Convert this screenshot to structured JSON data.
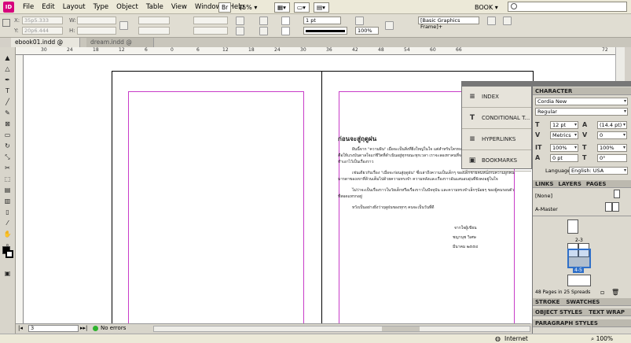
{
  "app": {
    "logo": "ID"
  },
  "menu": [
    "File",
    "Edit",
    "Layout",
    "Type",
    "Object",
    "Table",
    "View",
    "Window",
    "Help"
  ],
  "menubar": {
    "zoom": "75%",
    "workspace": "BOOK",
    "search_placeholder": ""
  },
  "control": {
    "x_label": "X:",
    "x_value": "35p5.333",
    "y_label": "Y:",
    "y_value": "20p6.444",
    "w_label": "W:",
    "h_label": "H:",
    "stroke_weight": "1 pt",
    "opacity": "100%",
    "frame_style": "[Basic Graphics Frame]+"
  },
  "tabs": [
    {
      "label": "ebook01.indd @ 75%",
      "close": "×"
    },
    {
      "label": "dream.indd @ 93%",
      "close": "×"
    }
  ],
  "ruler_ticks": [
    "30",
    "24",
    "18",
    "12",
    "6",
    "0",
    "6",
    "12",
    "18",
    "24",
    "30",
    "36",
    "42",
    "48",
    "54",
    "60",
    "66",
    "72"
  ],
  "page": {
    "heading": "ก่อนจะสู่ฤดูฝน",
    "para1_line1": "ฝันนี้จาก \"ความฝัน\" เมื่อจะเป็นสิ่งที่ยิ่งใหญ่ในใจ แต่สำหรับใครหลายคน",
    "para1_line2": "คือให้แรงบันดาลใจแก่ชีวิตที่ดำเนินอยู่ทุกขณะทุกเวลา เราจะลองหาคนที่จะเก็บสิ่งต่างๆเอาไว้",
    "para1_line3": "ทำเอาไว้เป็นเรื่องราว",
    "para2_line1": "เช่นเดียวกับเรื่อง \"เมื่อจะก่อนสู่ฤดูฝน\" ซึ่งเล่าถึงความเป็นเด็กๆ ของเด็กชายคนหนึ่งกับความผูกพัน",
    "para2_line2": "มารดาของเขาที่ล้วนเต็มไปด้วยความทรงจำ ความหลังและเรื่องราวอันแสนอบอุ่นที่ยังคงอยู่ในใจ",
    "para3_line1": "ไม่ว่าจะเป็นเรื่องราวในวัยเด็กหรือเรื่องราวในปัจจุบัน และความทรงจำเล็กๆน้อยๆ ของผู้คนรอบตัว",
    "para3_line2": "ที่สอดแทรกอยู่",
    "closing": "หวังเป็นอย่างยิ่งว่าฤดูฝนของทุกๆ คนจะเป็นวันที่ดี",
    "sig1": "จากใจผู้เขียน",
    "sig2": "ชญานุช วิเศษ",
    "sig3": "มีนาคม ๒๕๕๔"
  },
  "float_panel": [
    {
      "icon": "≡",
      "label": "INDEX"
    },
    {
      "icon": "T",
      "label": "CONDITIONAL T..."
    },
    {
      "icon": "≡",
      "label": "HYPERLINKS"
    },
    {
      "icon": "▣",
      "label": "BOOKMARKS"
    }
  ],
  "character": {
    "title": "CHARACTER",
    "font": "Cordia New",
    "style": "Regular",
    "size": "12 pt",
    "leading": "(14.4 pt)",
    "kerning": "Metrics",
    "tracking": "0",
    "vscale": "100%",
    "hscale": "100%",
    "baseline": "0 pt",
    "skew": "0°",
    "language_label": "Language:",
    "language": "English: USA"
  },
  "pages_panel": {
    "tabs": [
      "LINKS",
      "LAYERS",
      "PAGES"
    ],
    "none_label": "[None]",
    "master_label": "A-Master",
    "spread1": "2-3",
    "spread2": "4-5",
    "footer": "48 Pages in 25 Spreads"
  },
  "bottom_panels": {
    "stroke": "STROKE",
    "swatches": "SWATCHES",
    "object_styles": "OBJECT STYLES",
    "text_wrap": "TEXT WRAP",
    "paragraph_styles": "PARAGRAPH STYLES"
  },
  "statusbar": {
    "page": "3",
    "errors": "No errors"
  },
  "browser": {
    "zone": "Internet",
    "zoom": "100%"
  },
  "colors": {
    "margin": "#c83cc8",
    "accent": "#d6007c",
    "selected_spread": "#3070c8"
  }
}
